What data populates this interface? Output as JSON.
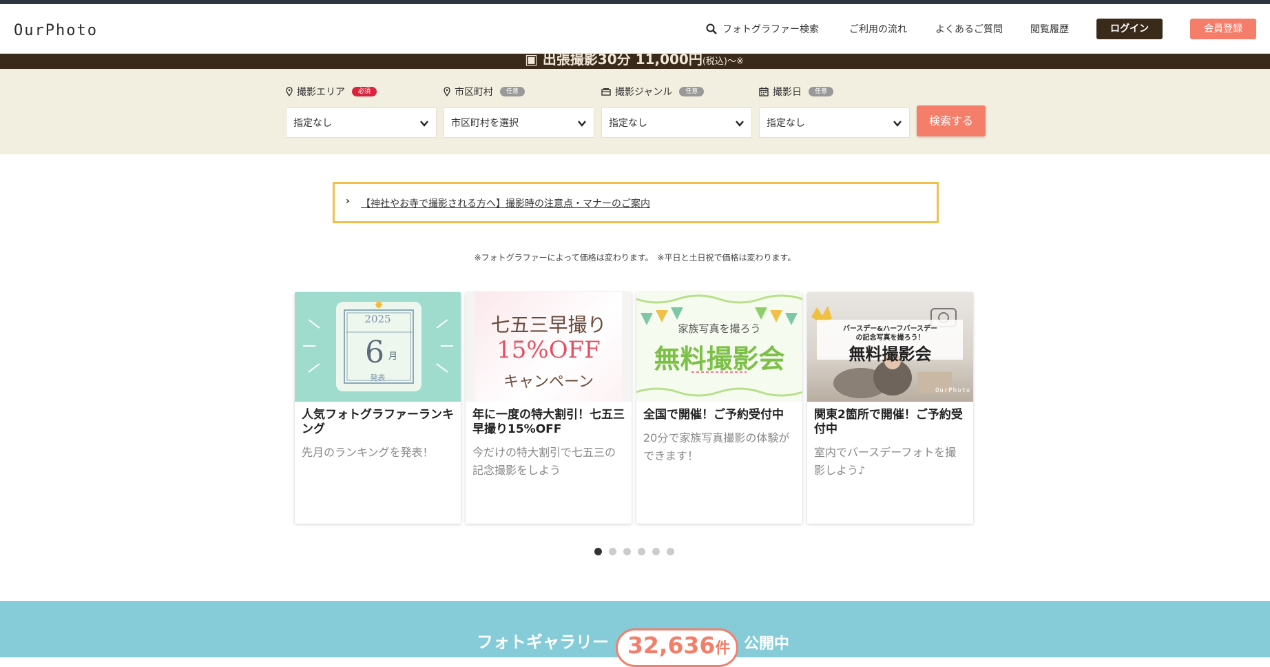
{
  "header": {
    "logo": "OurPhoto",
    "nav": {
      "search": "フォトグラファー検索",
      "flow": "ご利用の流れ",
      "faq": "よくあるご質問",
      "history": "閲覧履歴"
    },
    "login": "ログイン",
    "register": "会員登録"
  },
  "promo": {
    "text": "出張撮影30分 11,000円",
    "tax": "(税込)〜※"
  },
  "search": {
    "fields": [
      {
        "label": "撮影エリア",
        "tag": "必須",
        "value": "指定なし"
      },
      {
        "label": "市区町村",
        "tag": "任意",
        "value": "市区町村を選択"
      },
      {
        "label": "撮影ジャンル",
        "tag": "任意",
        "value": "指定なし"
      },
      {
        "label": "撮影日",
        "tag": "任意",
        "value": "指定なし"
      }
    ],
    "button": "検索する"
  },
  "notice": {
    "link": "【神社やお寺で撮影される方へ】撮影時の注意点・マナーのご案内"
  },
  "price_note": "※フォトグラファーによって価格は変わります。　※平日と土日祝で価格は変わります。",
  "cards": [
    {
      "title": "人気フォトグラファーランキング",
      "desc": "先月のランキングを発表！",
      "img": {
        "year": "2025",
        "month": "6",
        "month_unit": "月",
        "caption": "発表"
      }
    },
    {
      "title": "年に一度の特大割引！七五三早撮り15%OFF",
      "desc": "今だけの特大割引で七五三の記念撮影をしよう",
      "img": {
        "line1": "七五三早撮り",
        "line2": "15%OFF",
        "line3": "キャンペーン"
      }
    },
    {
      "title": "全国で開催！ご予約受付中",
      "desc": "20分で家族写真撮影の体験ができます！",
      "img": {
        "line1": "家族写真を撮ろう",
        "line2": "無料撮影会"
      }
    },
    {
      "title": "関東2箇所で開催！ご予約受付中",
      "desc": "室内でバースデーフォトを撮影しよう♪",
      "img": {
        "line1": "バースデー&ハーフバースデー",
        "line2": "の記念写真を撮ろう！",
        "line3": "無料撮影会",
        "brand": "OurPhoto"
      }
    }
  ],
  "carousel": {
    "count": 6,
    "active": 0
  },
  "gallery": {
    "label": "フォトギャラリー",
    "count": "32,636",
    "unit": "件",
    "tail": "公開中"
  },
  "colors": {
    "accent": "#f47e6a",
    "dark": "#3a2a1a",
    "panel": "#f3efe0",
    "teal": "#85ccd8",
    "notice_border": "#f0c04a"
  }
}
